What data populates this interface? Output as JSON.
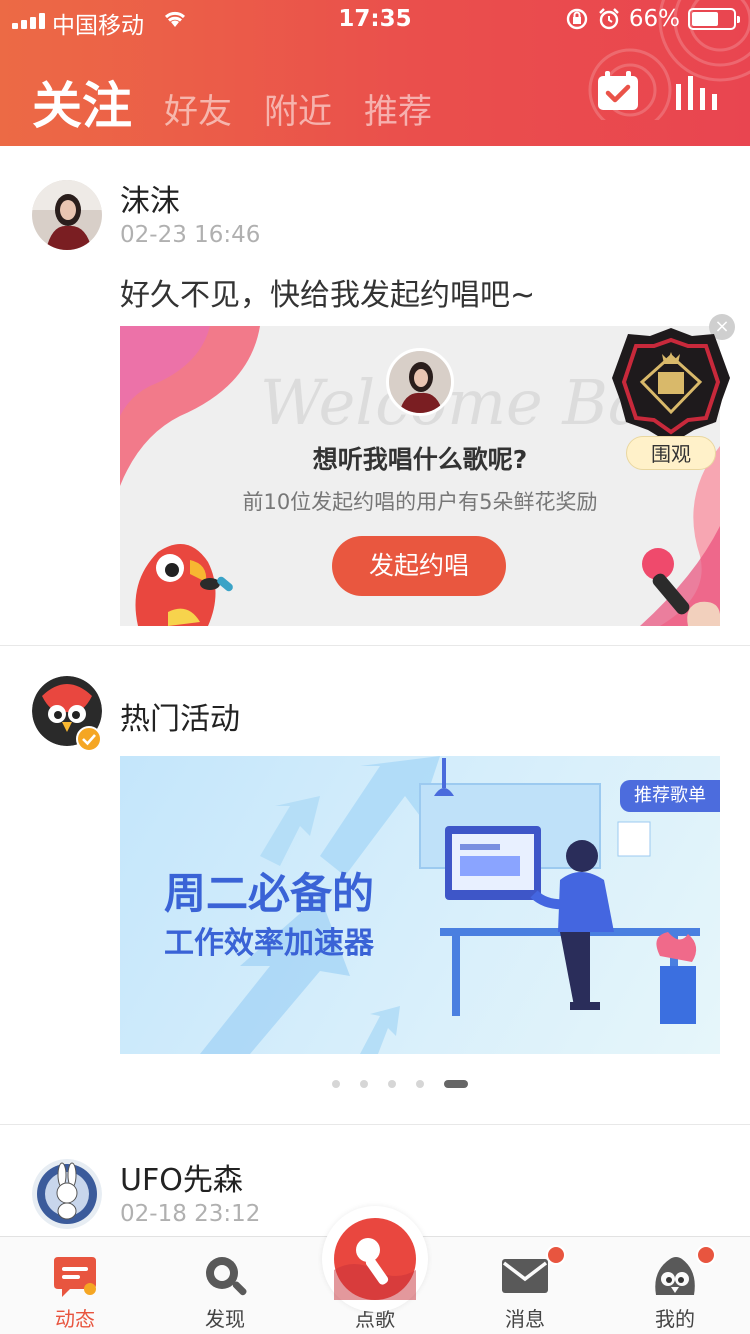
{
  "status_bar": {
    "carrier": "中国移动",
    "time": "17:35",
    "battery_text": "66%",
    "battery_level": 0.66
  },
  "header": {
    "tabs": [
      {
        "label": "关注",
        "active": true
      },
      {
        "label": "好友",
        "active": false
      },
      {
        "label": "附近",
        "active": false
      },
      {
        "label": "推荐",
        "active": false
      }
    ],
    "icons": [
      "calendar-check-icon",
      "equalizer-icon"
    ]
  },
  "posts": [
    {
      "name": "沫沫",
      "date": "02-23 16:46",
      "text": "好久不见，快给我发起约唱吧~",
      "card": {
        "watermark": "Welcome Back",
        "question": "想听我唱什么歌呢?",
        "subtitle": "前10位发起约唱的用户有5朵鲜花奖励",
        "button": "发起约唱",
        "badge_label": "围观"
      }
    },
    {
      "name": "热门活动",
      "banner": {
        "title": "周二必备的",
        "subtitle": "工作效率加速器",
        "tag": "推荐歌单"
      },
      "carousel_pages": 5,
      "carousel_active": 5
    },
    {
      "name": "UFO先森",
      "date": "02-18 23:12"
    }
  ],
  "bottom_nav": [
    {
      "label": "动态",
      "icon": "feed-icon",
      "active": true
    },
    {
      "label": "发现",
      "icon": "search-icon",
      "active": false
    },
    {
      "label": "点歌",
      "icon": "microphone-icon",
      "active": false
    },
    {
      "label": "消息",
      "icon": "mail-icon",
      "active": false,
      "badge": true
    },
    {
      "label": "我的",
      "icon": "profile-bird-icon",
      "active": false,
      "badge": true
    }
  ],
  "colors": {
    "accent": "#e8553f",
    "header_start": "#ec6a45",
    "header_end": "#e94550",
    "banner_text": "#3a63d6"
  }
}
